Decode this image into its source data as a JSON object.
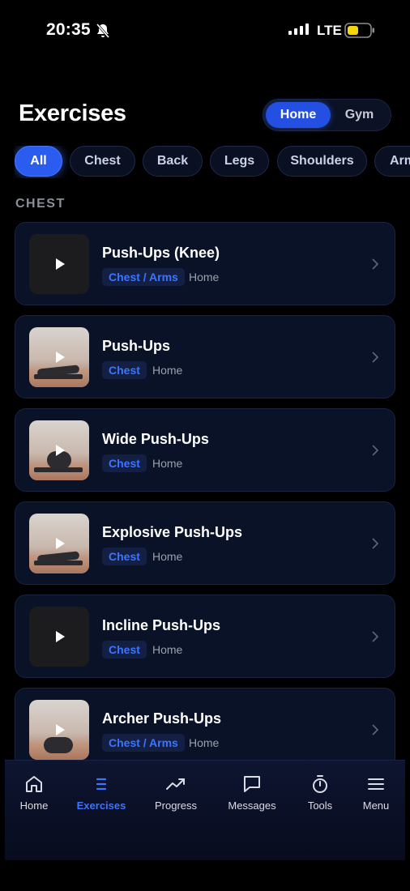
{
  "status": {
    "time": "20:35",
    "network": "LTE"
  },
  "header": {
    "title": "Exercises",
    "segments": [
      "Home",
      "Gym"
    ],
    "selected_segment": "Home"
  },
  "filters": {
    "chips": [
      "All",
      "Chest",
      "Back",
      "Legs",
      "Shoulders",
      "Arms"
    ],
    "selected": "All"
  },
  "section": {
    "label": "CHEST"
  },
  "exercises": [
    {
      "name": "Push-Ups (Knee)",
      "tag": "Chest / Arms",
      "location": "Home",
      "thumbnail": "dark"
    },
    {
      "name": "Push-Ups",
      "tag": "Chest",
      "location": "Home",
      "thumbnail": "photo"
    },
    {
      "name": "Wide Push-Ups",
      "tag": "Chest",
      "location": "Home",
      "thumbnail": "photo"
    },
    {
      "name": "Explosive Push-Ups",
      "tag": "Chest",
      "location": "Home",
      "thumbnail": "photo"
    },
    {
      "name": "Incline Push-Ups",
      "tag": "Chest",
      "location": "Home",
      "thumbnail": "dark"
    },
    {
      "name": "Archer Push-Ups",
      "tag": "Chest / Arms",
      "location": "Home",
      "thumbnail": "photo"
    }
  ],
  "tabbar": {
    "items": [
      {
        "label": "Home",
        "icon": "home-icon"
      },
      {
        "label": "Exercises",
        "icon": "list-icon"
      },
      {
        "label": "Progress",
        "icon": "trending-up-icon"
      },
      {
        "label": "Messages",
        "icon": "message-icon"
      },
      {
        "label": "Tools",
        "icon": "stopwatch-icon"
      },
      {
        "label": "Menu",
        "icon": "menu-icon"
      }
    ],
    "active": "Exercises"
  },
  "colors": {
    "accent": "#2a5cf0",
    "tag_text": "#3b74ff",
    "card_bg": "#0a1228",
    "background": "#000000"
  }
}
